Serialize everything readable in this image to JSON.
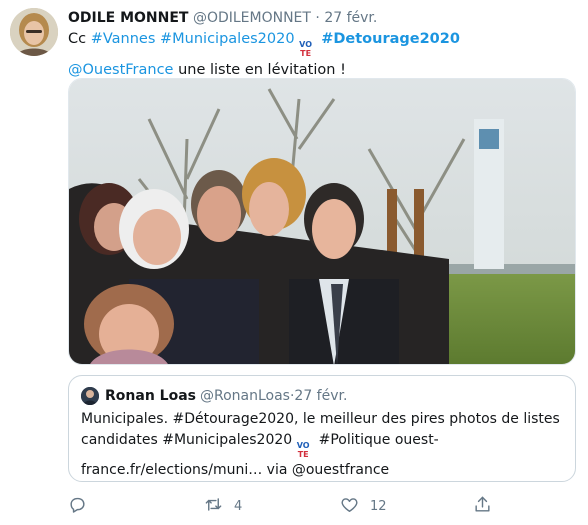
{
  "tweet": {
    "author_name": "ODILE MONNET",
    "author_handle": "@ODILEMONNET",
    "separator": "·",
    "date": "27 févr.",
    "text": {
      "cc": "Cc ",
      "tag_vannes": "#Vannes",
      "tag_municipales": "#Municipales2020",
      "tag_detourage": "#Detourage2020",
      "mention": "@OuestFrance",
      "rest": " une liste en lévitation !"
    },
    "vote_emoji": {
      "line1": "VO",
      "line2": "TE"
    }
  },
  "quote": {
    "author_name": "Ronan Loas",
    "author_handle": "@RonanLoas",
    "separator": "·",
    "date": "27 févr.",
    "text_part1": "Municipales. #Détourage2020, le meilleur des pires photos de listes candidates #Municipales2020",
    "text_part2": " #Politique ouest-france.fr/elections/muni… via @ouestfrance"
  },
  "actions": {
    "reply_count": "",
    "retweet_count": "4",
    "like_count": "12"
  },
  "colors": {
    "link": "#1b95e0",
    "secondary_text": "#657786",
    "border": "#ccd6dd"
  },
  "icons": [
    "reply-icon",
    "retweet-icon",
    "heart-icon",
    "share-icon"
  ]
}
